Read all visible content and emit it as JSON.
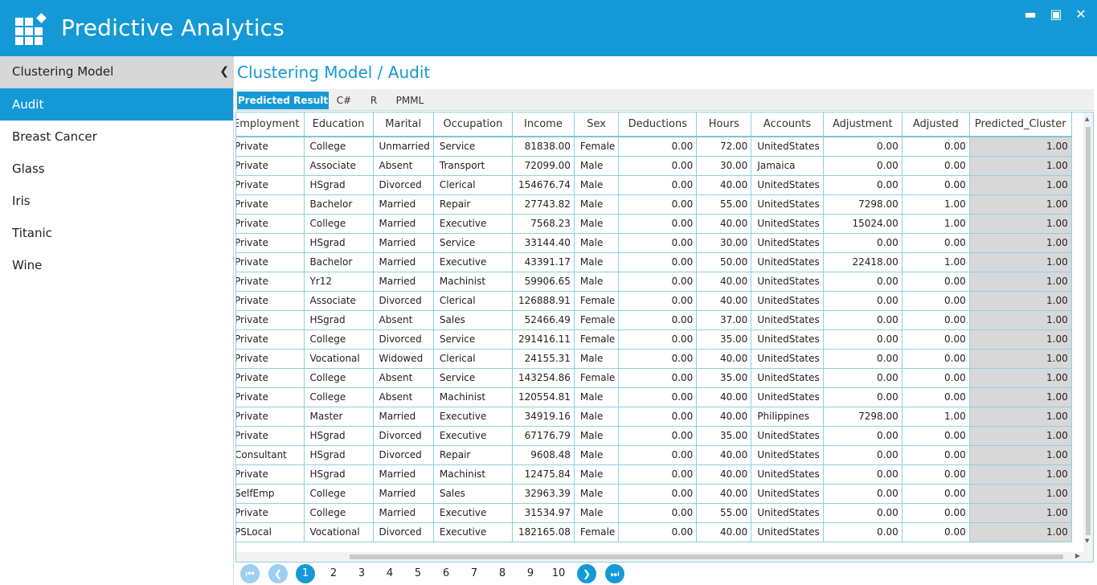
{
  "app": {
    "title": "Predictive Analytics"
  },
  "window_controls": {
    "minimize": "▬",
    "restore": "▣",
    "close": "✕"
  },
  "sidebar": {
    "header": "Clustering Model",
    "items": [
      {
        "label": "Audit",
        "active": true
      },
      {
        "label": "Breast Cancer"
      },
      {
        "label": "Glass"
      },
      {
        "label": "Iris"
      },
      {
        "label": "Titanic"
      },
      {
        "label": "Wine"
      }
    ]
  },
  "breadcrumb": "Clustering Model / Audit",
  "tabs": [
    "Predicted Result",
    "C#",
    "R",
    "PMML"
  ],
  "table": {
    "columns": [
      "Employment",
      "Education",
      "Marital",
      "Occupation",
      "Income",
      "Sex",
      "Deductions",
      "Hours",
      "Accounts",
      "Adjustment",
      "Adjusted",
      "Predicted_Cluster"
    ],
    "rows": [
      [
        "Private",
        "College",
        "Unmarried",
        "Service",
        "81838.00",
        "Female",
        "0.00",
        "72.00",
        "UnitedStates",
        "0.00",
        "0.00",
        "1.00"
      ],
      [
        "Private",
        "Associate",
        "Absent",
        "Transport",
        "72099.00",
        "Male",
        "0.00",
        "30.00",
        "Jamaica",
        "0.00",
        "0.00",
        "1.00"
      ],
      [
        "Private",
        "HSgrad",
        "Divorced",
        "Clerical",
        "154676.74",
        "Male",
        "0.00",
        "40.00",
        "UnitedStates",
        "0.00",
        "0.00",
        "1.00"
      ],
      [
        "Private",
        "Bachelor",
        "Married",
        "Repair",
        "27743.82",
        "Male",
        "0.00",
        "55.00",
        "UnitedStates",
        "7298.00",
        "1.00",
        "1.00"
      ],
      [
        "Private",
        "College",
        "Married",
        "Executive",
        "7568.23",
        "Male",
        "0.00",
        "40.00",
        "UnitedStates",
        "15024.00",
        "1.00",
        "1.00"
      ],
      [
        "Private",
        "HSgrad",
        "Married",
        "Service",
        "33144.40",
        "Male",
        "0.00",
        "30.00",
        "UnitedStates",
        "0.00",
        "0.00",
        "1.00"
      ],
      [
        "Private",
        "Bachelor",
        "Married",
        "Executive",
        "43391.17",
        "Male",
        "0.00",
        "50.00",
        "UnitedStates",
        "22418.00",
        "1.00",
        "1.00"
      ],
      [
        "Private",
        "Yr12",
        "Married",
        "Machinist",
        "59906.65",
        "Male",
        "0.00",
        "40.00",
        "UnitedStates",
        "0.00",
        "0.00",
        "1.00"
      ],
      [
        "Private",
        "Associate",
        "Divorced",
        "Clerical",
        "126888.91",
        "Female",
        "0.00",
        "40.00",
        "UnitedStates",
        "0.00",
        "0.00",
        "1.00"
      ],
      [
        "Private",
        "HSgrad",
        "Absent",
        "Sales",
        "52466.49",
        "Female",
        "0.00",
        "37.00",
        "UnitedStates",
        "0.00",
        "0.00",
        "1.00"
      ],
      [
        "Private",
        "College",
        "Divorced",
        "Service",
        "291416.11",
        "Female",
        "0.00",
        "35.00",
        "UnitedStates",
        "0.00",
        "0.00",
        "1.00"
      ],
      [
        "Private",
        "Vocational",
        "Widowed",
        "Clerical",
        "24155.31",
        "Male",
        "0.00",
        "40.00",
        "UnitedStates",
        "0.00",
        "0.00",
        "1.00"
      ],
      [
        "Private",
        "College",
        "Absent",
        "Service",
        "143254.86",
        "Female",
        "0.00",
        "35.00",
        "UnitedStates",
        "0.00",
        "0.00",
        "1.00"
      ],
      [
        "Private",
        "College",
        "Absent",
        "Machinist",
        "120554.81",
        "Male",
        "0.00",
        "40.00",
        "UnitedStates",
        "0.00",
        "0.00",
        "1.00"
      ],
      [
        "Private",
        "Master",
        "Married",
        "Executive",
        "34919.16",
        "Male",
        "0.00",
        "40.00",
        "Philippines",
        "7298.00",
        "1.00",
        "1.00"
      ],
      [
        "Private",
        "HSgrad",
        "Divorced",
        "Executive",
        "67176.79",
        "Male",
        "0.00",
        "35.00",
        "UnitedStates",
        "0.00",
        "0.00",
        "1.00"
      ],
      [
        "Consultant",
        "HSgrad",
        "Divorced",
        "Repair",
        "9608.48",
        "Male",
        "0.00",
        "40.00",
        "UnitedStates",
        "0.00",
        "0.00",
        "1.00"
      ],
      [
        "Private",
        "HSgrad",
        "Married",
        "Machinist",
        "12475.84",
        "Male",
        "0.00",
        "40.00",
        "UnitedStates",
        "0.00",
        "0.00",
        "1.00"
      ],
      [
        "SelfEmp",
        "College",
        "Married",
        "Sales",
        "32963.39",
        "Male",
        "0.00",
        "40.00",
        "UnitedStates",
        "0.00",
        "0.00",
        "1.00"
      ],
      [
        "Private",
        "College",
        "Married",
        "Executive",
        "31534.97",
        "Male",
        "0.00",
        "55.00",
        "UnitedStates",
        "0.00",
        "0.00",
        "1.00"
      ],
      [
        "PSLocal",
        "Vocational",
        "Divorced",
        "Executive",
        "182165.08",
        "Female",
        "0.00",
        "40.00",
        "UnitedStates",
        "0.00",
        "0.00",
        "1.00"
      ]
    ]
  },
  "pagination": {
    "pages": [
      "1",
      "2",
      "3",
      "4",
      "5",
      "6",
      "7",
      "8",
      "9",
      "10"
    ],
    "current": "1"
  }
}
